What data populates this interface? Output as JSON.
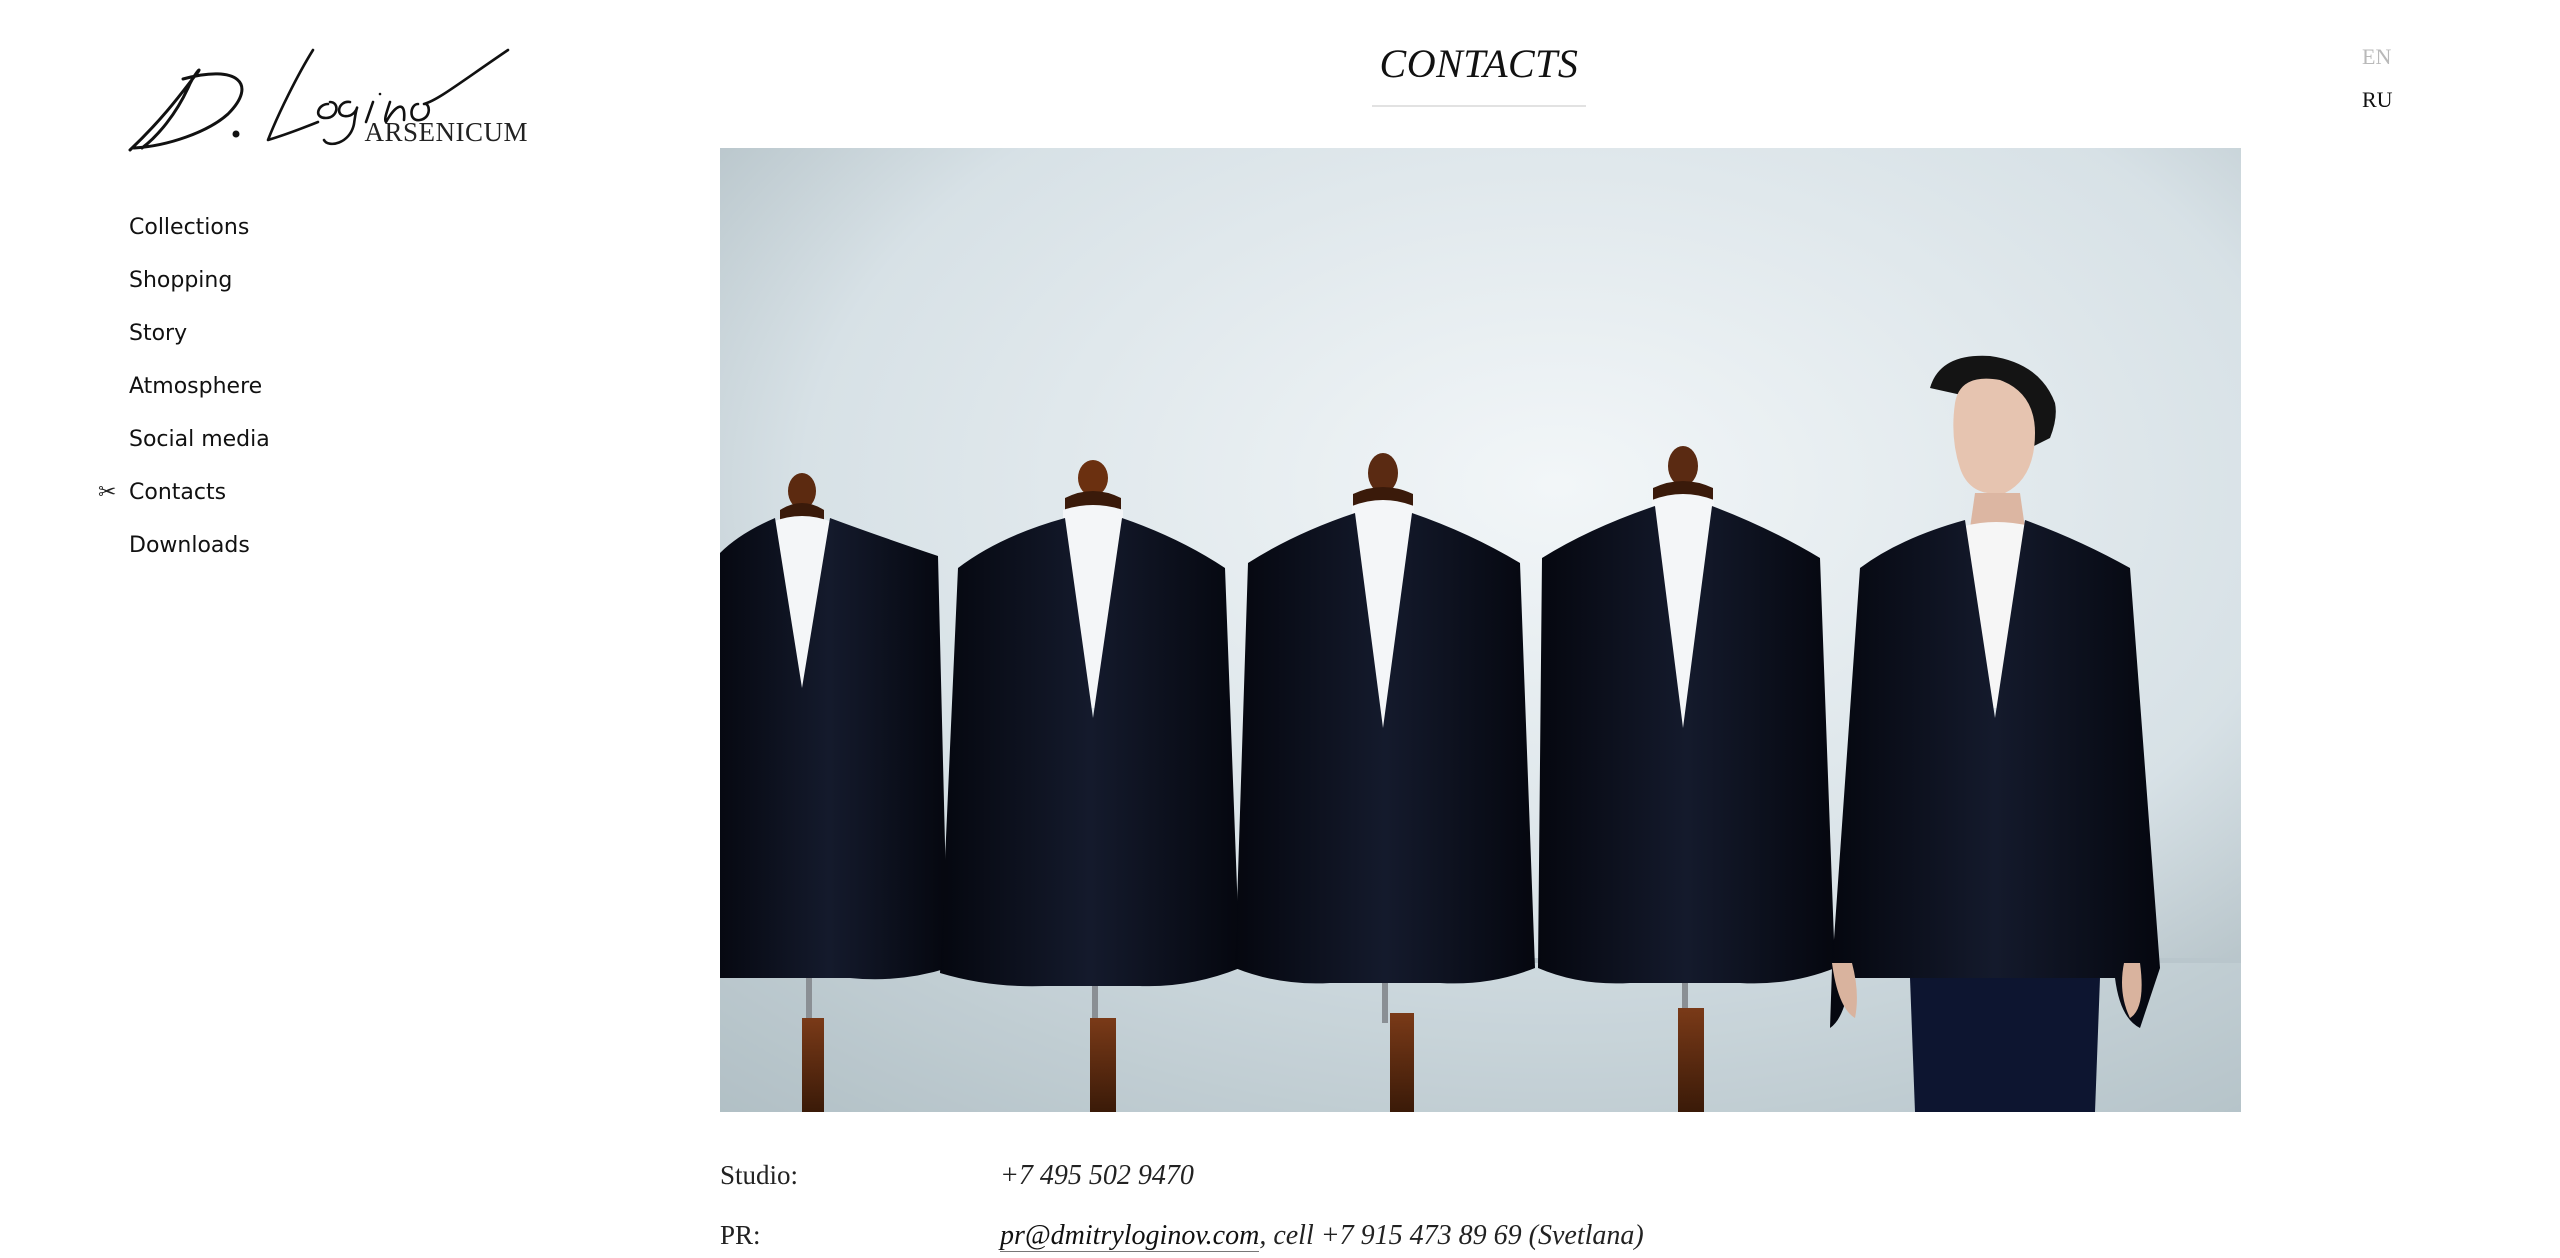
{
  "logo": {
    "script": "D.Loginov",
    "subtitle": "ARSENICUM"
  },
  "nav": {
    "items": [
      {
        "label": "Collections",
        "active": false
      },
      {
        "label": "Shopping",
        "active": false
      },
      {
        "label": "Story",
        "active": false
      },
      {
        "label": "Atmosphere",
        "active": false
      },
      {
        "label": "Social media",
        "active": false
      },
      {
        "label": "Contacts",
        "active": true
      },
      {
        "label": "Downloads",
        "active": false
      }
    ],
    "active_marker": "✂"
  },
  "header": {
    "title": "CONTACTS"
  },
  "lang": {
    "en": "EN",
    "ru": "RU"
  },
  "photo": {
    "alt": "Black tuxedo jackets on mannequins beside a man"
  },
  "contacts": {
    "studio_label": "Studio:",
    "studio_phone": "+7 495 502 9470",
    "pr_label": "PR:",
    "pr_email": "pr@dmitryloginov.com",
    "pr_rest": ", cell +7 915 473 89 69 (Svetlana)"
  },
  "colors": {
    "text": "#111111",
    "muted": "#b9b9b9",
    "divider": "#e2e2e2",
    "wall": "#c9d6dc",
    "jacket": "#0c1020"
  }
}
